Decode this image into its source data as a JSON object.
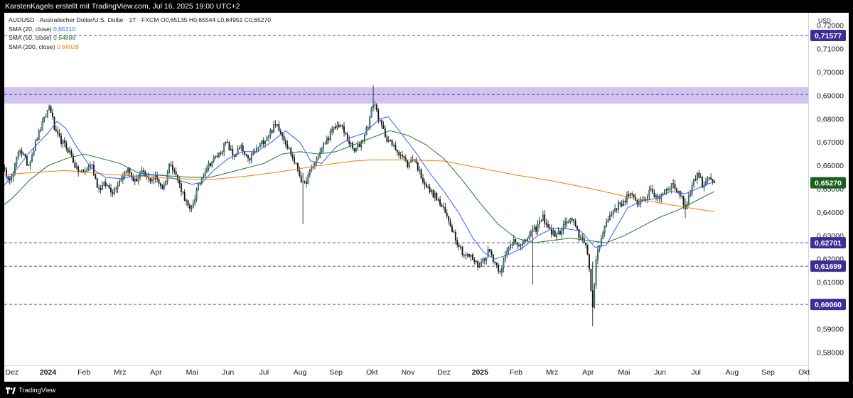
{
  "header": {
    "caption": "KarstenKagels erstellt mit TradingView.com, Jul 16, 2025 19:00 UTC+2"
  },
  "legend": {
    "symbol_line": "AUDUSD · Australischer Dollar/U.S. Dollar · 1T · FXCM  O0,65135  H0,65544  L0,64951  C0,65270",
    "sma20_label": "SMA (20, close)",
    "sma20_value": "0,65310",
    "sma50_label": "SMA (50, close)",
    "sma50_value": "0,64888",
    "sma200_label": "SMA (200, close)",
    "sma200_value": "0,64028"
  },
  "footer": {
    "brand": "TradingView"
  },
  "chart_data": {
    "type": "candlestick",
    "currency_label": "USD",
    "ylim": [
      0.5745,
      0.7255
    ],
    "y_ticks": [
      "0,72000",
      "0,71000",
      "0,70000",
      "0,69000",
      "0,68000",
      "0,67000",
      "0,66000",
      "0,65000",
      "0,64000",
      "0,63000",
      "0,62000",
      "0,61000",
      "0,60000",
      "0,59000",
      "0,58000"
    ],
    "x_ticks": [
      {
        "label": "Dez",
        "month": -1,
        "bold": false
      },
      {
        "label": "2024",
        "month": 0,
        "bold": true
      },
      {
        "label": "Feb",
        "month": 1,
        "bold": false
      },
      {
        "label": "Mrz",
        "month": 2,
        "bold": false
      },
      {
        "label": "Apr",
        "month": 3,
        "bold": false
      },
      {
        "label": "Mai",
        "month": 4,
        "bold": false
      },
      {
        "label": "Jun",
        "month": 5,
        "bold": false
      },
      {
        "label": "Jul",
        "month": 6,
        "bold": false
      },
      {
        "label": "Aug",
        "month": 7,
        "bold": false
      },
      {
        "label": "Sep",
        "month": 8,
        "bold": false
      },
      {
        "label": "Okt",
        "month": 9,
        "bold": false
      },
      {
        "label": "Nov",
        "month": 10,
        "bold": false
      },
      {
        "label": "Dez",
        "month": 11,
        "bold": false
      },
      {
        "label": "2025",
        "month": 12,
        "bold": true
      },
      {
        "label": "Feb",
        "month": 13,
        "bold": false
      },
      {
        "label": "Mrz",
        "month": 14,
        "bold": false
      },
      {
        "label": "Apr",
        "month": 15,
        "bold": false
      },
      {
        "label": "Mai",
        "month": 16,
        "bold": false
      },
      {
        "label": "Jun",
        "month": 17,
        "bold": false
      },
      {
        "label": "Jul",
        "month": 18,
        "bold": false
      },
      {
        "label": "Aug",
        "month": 19,
        "bold": false
      },
      {
        "label": "Sep",
        "month": 20,
        "bold": false
      },
      {
        "label": "Okt",
        "month": 21,
        "bold": false
      }
    ],
    "zone": {
      "low": 0.6866,
      "high": 0.6936,
      "color": "#c9b8ee"
    },
    "levels": [
      {
        "value": 0.71577,
        "label": "0,71577",
        "color": "#3f2d96"
      },
      {
        "value": 0.6905,
        "label": "",
        "color": "#3f2d96"
      },
      {
        "value": 0.62701,
        "label": "0,62701",
        "color": "#3f2d96"
      },
      {
        "value": 0.61699,
        "label": "0,61699",
        "color": "#3f2d96"
      },
      {
        "value": 0.6006,
        "label": "0,60060",
        "color": "#3f2d96"
      }
    ],
    "last_price": {
      "value": 0.6527,
      "label": "0,65270",
      "color": "#1b5e20"
    },
    "colors": {
      "up": "#26a69a",
      "down": "#111111",
      "wick": "#111111",
      "sma20": "#2962ff",
      "sma50": "#1b7a2c",
      "sma200": "#f57c00"
    },
    "path": [
      {
        "m": -1.3,
        "v": 0.659
      },
      {
        "m": -1.0,
        "v": 0.654
      },
      {
        "m": -0.8,
        "v": 0.668
      },
      {
        "m": -0.55,
        "v": 0.66
      },
      {
        "m": -0.3,
        "v": 0.672
      },
      {
        "m": -0.1,
        "v": 0.68
      },
      {
        "m": 0.05,
        "v": 0.686
      },
      {
        "m": 0.2,
        "v": 0.674
      },
      {
        "m": 0.4,
        "v": 0.67
      },
      {
        "m": 0.6,
        "v": 0.666
      },
      {
        "m": 0.8,
        "v": 0.658
      },
      {
        "m": 1.0,
        "v": 0.657
      },
      {
        "m": 1.2,
        "v": 0.661
      },
      {
        "m": 1.4,
        "v": 0.65
      },
      {
        "m": 1.6,
        "v": 0.652
      },
      {
        "m": 1.8,
        "v": 0.649
      },
      {
        "m": 2.0,
        "v": 0.654
      },
      {
        "m": 2.2,
        "v": 0.659
      },
      {
        "m": 2.4,
        "v": 0.653
      },
      {
        "m": 2.6,
        "v": 0.657
      },
      {
        "m": 2.8,
        "v": 0.654
      },
      {
        "m": 3.0,
        "v": 0.655
      },
      {
        "m": 3.2,
        "v": 0.65
      },
      {
        "m": 3.4,
        "v": 0.662
      },
      {
        "m": 3.55,
        "v": 0.656
      },
      {
        "m": 3.75,
        "v": 0.648
      },
      {
        "m": 3.95,
        "v": 0.64
      },
      {
        "m": 4.15,
        "v": 0.65
      },
      {
        "m": 4.35,
        "v": 0.658
      },
      {
        "m": 4.55,
        "v": 0.662
      },
      {
        "m": 4.75,
        "v": 0.665
      },
      {
        "m": 4.95,
        "v": 0.67
      },
      {
        "m": 5.15,
        "v": 0.664
      },
      {
        "m": 5.35,
        "v": 0.668
      },
      {
        "m": 5.55,
        "v": 0.662
      },
      {
        "m": 5.75,
        "v": 0.666
      },
      {
        "m": 5.95,
        "v": 0.67
      },
      {
        "m": 6.15,
        "v": 0.674
      },
      {
        "m": 6.35,
        "v": 0.678
      },
      {
        "m": 6.55,
        "v": 0.672
      },
      {
        "m": 6.75,
        "v": 0.665
      },
      {
        "m": 6.95,
        "v": 0.658
      },
      {
        "m": 7.1,
        "v": 0.651
      },
      {
        "m": 7.3,
        "v": 0.658
      },
      {
        "m": 7.5,
        "v": 0.664
      },
      {
        "m": 7.7,
        "v": 0.67
      },
      {
        "m": 7.9,
        "v": 0.675
      },
      {
        "m": 8.1,
        "v": 0.678
      },
      {
        "m": 8.3,
        "v": 0.672
      },
      {
        "m": 8.5,
        "v": 0.666
      },
      {
        "m": 8.7,
        "v": 0.67
      },
      {
        "m": 8.9,
        "v": 0.678
      },
      {
        "m": 9.05,
        "v": 0.688
      },
      {
        "m": 9.2,
        "v": 0.679
      },
      {
        "m": 9.4,
        "v": 0.672
      },
      {
        "m": 9.6,
        "v": 0.668
      },
      {
        "m": 9.8,
        "v": 0.665
      },
      {
        "m": 10.0,
        "v": 0.66
      },
      {
        "m": 10.15,
        "v": 0.664
      },
      {
        "m": 10.35,
        "v": 0.656
      },
      {
        "m": 10.55,
        "v": 0.65
      },
      {
        "m": 10.75,
        "v": 0.647
      },
      {
        "m": 10.95,
        "v": 0.642
      },
      {
        "m": 11.15,
        "v": 0.636
      },
      {
        "m": 11.35,
        "v": 0.628
      },
      {
        "m": 11.55,
        "v": 0.622
      },
      {
        "m": 11.75,
        "v": 0.621
      },
      {
        "m": 11.95,
        "v": 0.617
      },
      {
        "m": 12.1,
        "v": 0.62
      },
      {
        "m": 12.25,
        "v": 0.624
      },
      {
        "m": 12.4,
        "v": 0.619
      },
      {
        "m": 12.55,
        "v": 0.615
      },
      {
        "m": 12.75,
        "v": 0.623
      },
      {
        "m": 12.95,
        "v": 0.629
      },
      {
        "m": 13.15,
        "v": 0.625
      },
      {
        "m": 13.35,
        "v": 0.63
      },
      {
        "m": 13.55,
        "v": 0.633
      },
      {
        "m": 13.75,
        "v": 0.638
      },
      {
        "m": 13.95,
        "v": 0.632
      },
      {
        "m": 14.15,
        "v": 0.63
      },
      {
        "m": 14.35,
        "v": 0.635
      },
      {
        "m": 14.55,
        "v": 0.637
      },
      {
        "m": 14.75,
        "v": 0.63
      },
      {
        "m": 14.95,
        "v": 0.627
      },
      {
        "m": 15.05,
        "v": 0.613
      },
      {
        "m": 15.12,
        "v": 0.596
      },
      {
        "m": 15.22,
        "v": 0.62
      },
      {
        "m": 15.35,
        "v": 0.629
      },
      {
        "m": 15.55,
        "v": 0.637
      },
      {
        "m": 15.75,
        "v": 0.642
      },
      {
        "m": 15.95,
        "v": 0.644
      },
      {
        "m": 16.15,
        "v": 0.648
      },
      {
        "m": 16.35,
        "v": 0.644
      },
      {
        "m": 16.55,
        "v": 0.646
      },
      {
        "m": 16.75,
        "v": 0.649
      },
      {
        "m": 16.95,
        "v": 0.646
      },
      {
        "m": 17.15,
        "v": 0.65
      },
      {
        "m": 17.35,
        "v": 0.652
      },
      {
        "m": 17.55,
        "v": 0.648
      },
      {
        "m": 17.7,
        "v": 0.642
      },
      {
        "m": 17.9,
        "v": 0.652
      },
      {
        "m": 18.05,
        "v": 0.657
      },
      {
        "m": 18.2,
        "v": 0.651
      },
      {
        "m": 18.35,
        "v": 0.656
      },
      {
        "m": 18.5,
        "v": 0.6527
      }
    ],
    "sma20": [
      {
        "m": -1.4,
        "v": 0.648
      },
      {
        "m": -1.0,
        "v": 0.656
      },
      {
        "m": -0.5,
        "v": 0.666
      },
      {
        "m": 0.0,
        "v": 0.674
      },
      {
        "m": 0.25,
        "v": 0.679
      },
      {
        "m": 0.5,
        "v": 0.676
      },
      {
        "m": 0.8,
        "v": 0.668
      },
      {
        "m": 1.2,
        "v": 0.659
      },
      {
        "m": 1.6,
        "v": 0.655
      },
      {
        "m": 2.0,
        "v": 0.6545
      },
      {
        "m": 2.4,
        "v": 0.6555
      },
      {
        "m": 2.8,
        "v": 0.656
      },
      {
        "m": 3.2,
        "v": 0.656
      },
      {
        "m": 3.6,
        "v": 0.654
      },
      {
        "m": 4.0,
        "v": 0.652
      },
      {
        "m": 4.3,
        "v": 0.653
      },
      {
        "m": 4.6,
        "v": 0.658
      },
      {
        "m": 5.0,
        "v": 0.663
      },
      {
        "m": 5.4,
        "v": 0.666
      },
      {
        "m": 5.8,
        "v": 0.666
      },
      {
        "m": 6.2,
        "v": 0.67
      },
      {
        "m": 6.6,
        "v": 0.675
      },
      {
        "m": 7.0,
        "v": 0.67
      },
      {
        "m": 7.3,
        "v": 0.662
      },
      {
        "m": 7.6,
        "v": 0.661
      },
      {
        "m": 8.0,
        "v": 0.668
      },
      {
        "m": 8.4,
        "v": 0.672
      },
      {
        "m": 8.8,
        "v": 0.674
      },
      {
        "m": 9.2,
        "v": 0.68
      },
      {
        "m": 9.45,
        "v": 0.681
      },
      {
        "m": 9.8,
        "v": 0.674
      },
      {
        "m": 10.2,
        "v": 0.666
      },
      {
        "m": 10.6,
        "v": 0.657
      },
      {
        "m": 11.0,
        "v": 0.649
      },
      {
        "m": 11.4,
        "v": 0.64
      },
      {
        "m": 11.8,
        "v": 0.629
      },
      {
        "m": 12.1,
        "v": 0.623
      },
      {
        "m": 12.4,
        "v": 0.62
      },
      {
        "m": 12.8,
        "v": 0.622
      },
      {
        "m": 13.2,
        "v": 0.625
      },
      {
        "m": 13.6,
        "v": 0.63
      },
      {
        "m": 14.0,
        "v": 0.633
      },
      {
        "m": 14.4,
        "v": 0.633
      },
      {
        "m": 14.8,
        "v": 0.632
      },
      {
        "m": 15.2,
        "v": 0.625
      },
      {
        "m": 15.5,
        "v": 0.626
      },
      {
        "m": 15.8,
        "v": 0.634
      },
      {
        "m": 16.1,
        "v": 0.642
      },
      {
        "m": 16.5,
        "v": 0.645
      },
      {
        "m": 16.9,
        "v": 0.646
      },
      {
        "m": 17.3,
        "v": 0.649
      },
      {
        "m": 17.7,
        "v": 0.648
      },
      {
        "m": 18.0,
        "v": 0.65
      },
      {
        "m": 18.3,
        "v": 0.652
      },
      {
        "m": 18.5,
        "v": 0.6531
      }
    ],
    "sma50": [
      {
        "m": -1.4,
        "v": 0.641
      },
      {
        "m": -1.0,
        "v": 0.646
      },
      {
        "m": -0.5,
        "v": 0.654
      },
      {
        "m": 0.0,
        "v": 0.66
      },
      {
        "m": 0.5,
        "v": 0.663
      },
      {
        "m": 1.0,
        "v": 0.665
      },
      {
        "m": 1.5,
        "v": 0.663
      },
      {
        "m": 2.0,
        "v": 0.661
      },
      {
        "m": 2.5,
        "v": 0.657
      },
      {
        "m": 3.0,
        "v": 0.656
      },
      {
        "m": 3.5,
        "v": 0.6555
      },
      {
        "m": 4.0,
        "v": 0.655
      },
      {
        "m": 4.5,
        "v": 0.655
      },
      {
        "m": 5.0,
        "v": 0.657
      },
      {
        "m": 5.5,
        "v": 0.659
      },
      {
        "m": 6.0,
        "v": 0.661
      },
      {
        "m": 6.5,
        "v": 0.665
      },
      {
        "m": 7.0,
        "v": 0.666
      },
      {
        "m": 7.5,
        "v": 0.665
      },
      {
        "m": 8.0,
        "v": 0.666
      },
      {
        "m": 8.5,
        "v": 0.669
      },
      {
        "m": 9.0,
        "v": 0.672
      },
      {
        "m": 9.5,
        "v": 0.675
      },
      {
        "m": 10.0,
        "v": 0.673
      },
      {
        "m": 10.5,
        "v": 0.669
      },
      {
        "m": 11.0,
        "v": 0.663
      },
      {
        "m": 11.5,
        "v": 0.654
      },
      {
        "m": 12.0,
        "v": 0.644
      },
      {
        "m": 12.5,
        "v": 0.635
      },
      {
        "m": 13.0,
        "v": 0.629
      },
      {
        "m": 13.5,
        "v": 0.627
      },
      {
        "m": 14.0,
        "v": 0.628
      },
      {
        "m": 14.5,
        "v": 0.629
      },
      {
        "m": 15.0,
        "v": 0.628
      },
      {
        "m": 15.5,
        "v": 0.627
      },
      {
        "m": 16.0,
        "v": 0.63
      },
      {
        "m": 16.5,
        "v": 0.634
      },
      {
        "m": 17.0,
        "v": 0.638
      },
      {
        "m": 17.5,
        "v": 0.641
      },
      {
        "m": 18.0,
        "v": 0.645
      },
      {
        "m": 18.5,
        "v": 0.6489
      }
    ],
    "sma200": [
      {
        "m": -1.4,
        "v": 0.656
      },
      {
        "m": -0.5,
        "v": 0.657
      },
      {
        "m": 0.5,
        "v": 0.658
      },
      {
        "m": 1.5,
        "v": 0.6565
      },
      {
        "m": 2.5,
        "v": 0.6555
      },
      {
        "m": 3.5,
        "v": 0.6545
      },
      {
        "m": 4.5,
        "v": 0.654
      },
      {
        "m": 5.5,
        "v": 0.6555
      },
      {
        "m": 6.5,
        "v": 0.6575
      },
      {
        "m": 7.5,
        "v": 0.66
      },
      {
        "m": 8.5,
        "v": 0.662
      },
      {
        "m": 9.0,
        "v": 0.6625
      },
      {
        "m": 10.0,
        "v": 0.6625
      },
      {
        "m": 11.0,
        "v": 0.662
      },
      {
        "m": 12.0,
        "v": 0.659
      },
      {
        "m": 13.0,
        "v": 0.656
      },
      {
        "m": 14.0,
        "v": 0.6535
      },
      {
        "m": 15.0,
        "v": 0.6505
      },
      {
        "m": 16.0,
        "v": 0.647
      },
      {
        "m": 17.0,
        "v": 0.644
      },
      {
        "m": 18.0,
        "v": 0.6415
      },
      {
        "m": 18.5,
        "v": 0.6403
      }
    ],
    "extremes": [
      {
        "m": 7.1,
        "h": 0.657,
        "l": 0.635
      },
      {
        "m": 9.05,
        "h": 0.6944,
        "l": 0.684
      },
      {
        "m": 13.45,
        "h": 0.63,
        "l": 0.609
      },
      {
        "m": 15.12,
        "h": 0.619,
        "l": 0.5913
      },
      {
        "m": 17.7,
        "h": 0.646,
        "l": 0.6375
      }
    ]
  }
}
